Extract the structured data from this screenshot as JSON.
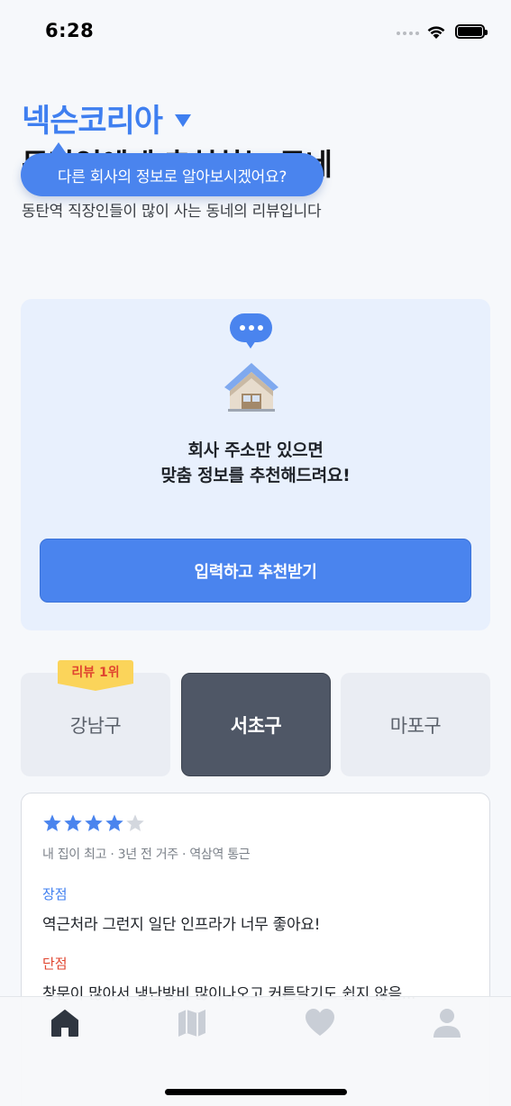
{
  "status_bar": {
    "time": "6:28"
  },
  "header": {
    "company": "넥슨코리아",
    "headline": "동탄역에게 추천하는 동네",
    "subtitle": "동탄역 직장인들이 많이 사는 동네의 리뷰입니다",
    "tooltip": "다른 회사의 정보로 알아보시겠어요?"
  },
  "recommend": {
    "line1": "회사 주소만 있으면",
    "line2": "맞춤 정보를 추천해드려요!",
    "button": "입력하고 추천받기"
  },
  "districts": {
    "badge": "리뷰 1위",
    "items": [
      {
        "label": "강남구",
        "active": false
      },
      {
        "label": "서초구",
        "active": true
      },
      {
        "label": "마포구",
        "active": false
      }
    ]
  },
  "review": {
    "rating": 4,
    "max_rating": 5,
    "meta": "내 집이 최고 · 3년 전 거주 · 역삼역 통근",
    "pros_label": "장점",
    "pros": "역근처라 그런지 일단 인프라가 너무 좋아요!",
    "cons_label": "단점",
    "cons": "창문이 많아서 냉난방비 많이나오고 커튼달기도 쉽지 않음..."
  },
  "tab_bar": {
    "items": [
      {
        "icon": "home-icon",
        "active": true
      },
      {
        "icon": "map-icon",
        "active": false
      },
      {
        "icon": "heart-icon",
        "active": false
      },
      {
        "icon": "profile-icon",
        "active": false
      }
    ]
  },
  "colors": {
    "accent": "#4a84ee",
    "badge": "#fbd45a",
    "cons": "#e0452f",
    "active_tab": "#4f5766"
  }
}
